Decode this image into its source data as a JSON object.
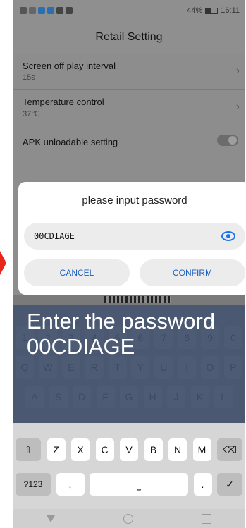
{
  "status_bar": {
    "battery": "44%",
    "time": "16:11"
  },
  "title": "Retail Setting",
  "settings": [
    {
      "title": "Screen off play interval",
      "value": "15s"
    },
    {
      "title": "Temperature control",
      "value": "37℃"
    },
    {
      "title": "APK unloadable setting"
    }
  ],
  "dialog": {
    "title": "please input password",
    "password_value": "00CDIAGE",
    "cancel_label": "CANCEL",
    "confirm_label": "CONFIRM"
  },
  "keyboard": {
    "row_numbers": [
      "1",
      "2",
      "3",
      "4",
      "5",
      "6",
      "7",
      "8",
      "9",
      "0"
    ],
    "row_q": [
      "Q",
      "W",
      "E",
      "R",
      "T",
      "Y",
      "U",
      "I",
      "O",
      "P"
    ],
    "row_a": [
      "A",
      "S",
      "D",
      "F",
      "G",
      "H",
      "J",
      "K",
      "L"
    ],
    "row_z": [
      "Z",
      "X",
      "C",
      "V",
      "B",
      "N",
      "M"
    ],
    "sym_label": "?123",
    "comma": ",",
    "period": "."
  },
  "overlay_text": "Enter the password 00CDIAGE",
  "colors": {
    "accent": "#1a73e8",
    "overlay": "#405069",
    "arrow": "#e8261c"
  }
}
